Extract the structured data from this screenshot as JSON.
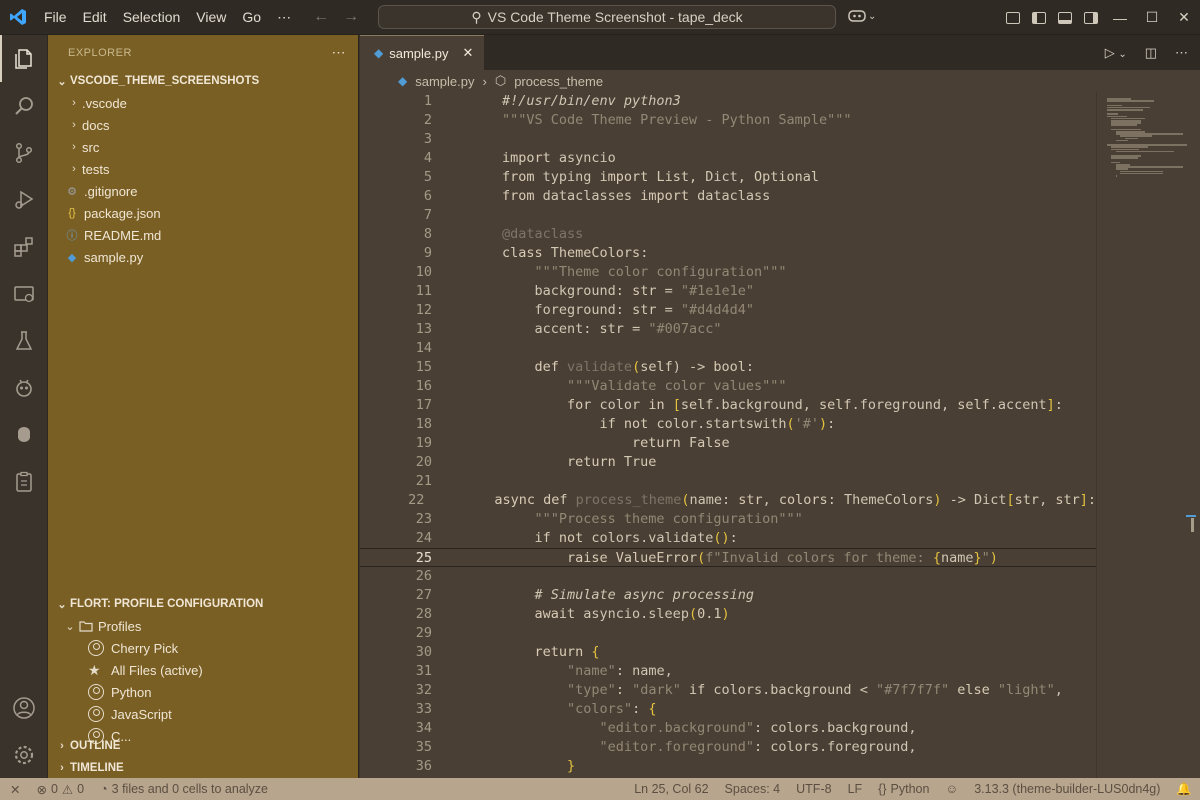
{
  "titlebar": {
    "menus": [
      "File",
      "Edit",
      "Selection",
      "View",
      "Go",
      "⋯"
    ],
    "command_center": "VS Code Theme Screenshot - tape_deck"
  },
  "sidebar": {
    "header": "EXPLORER",
    "root": "VSCODE_THEME_SCREENSHOTS",
    "folders": [
      ".vscode",
      "docs",
      "src",
      "tests"
    ],
    "files": [
      {
        "name": ".gitignore",
        "icon": "gear-icon"
      },
      {
        "name": "package.json",
        "icon": "braces-icon"
      },
      {
        "name": "README.md",
        "icon": "info-icon"
      },
      {
        "name": "sample.py",
        "icon": "python-icon"
      }
    ],
    "profile_section": "FLORT: PROFILE CONFIGURATION",
    "profiles_folder": "Profiles",
    "profiles": [
      "Cherry Pick",
      "All Files (active)",
      "Python",
      "JavaScript",
      "C..."
    ],
    "outline": "OUTLINE",
    "timeline": "TIMELINE"
  },
  "editor": {
    "tab_label": "sample.py",
    "breadcrumb": [
      "sample.py",
      "process_theme"
    ],
    "lines": [
      [
        [
          "#!/usr/bin/env python3",
          "c"
        ]
      ],
      [
        [
          "\"\"\"VS Code Theme Preview - Python Sample\"\"\"",
          "s"
        ]
      ],
      [],
      [
        [
          "import ",
          "k"
        ],
        [
          "asyncio",
          "n"
        ]
      ],
      [
        [
          "from ",
          "k"
        ],
        [
          "typing ",
          "n"
        ],
        [
          "import ",
          "k"
        ],
        [
          "List, ",
          "t"
        ],
        [
          "Dict",
          "n"
        ],
        [
          ", ",
          "t"
        ],
        [
          "Optional",
          "t"
        ]
      ],
      [
        [
          "from ",
          "k"
        ],
        [
          "dataclasses ",
          "n"
        ],
        [
          "import ",
          "k"
        ],
        [
          "dataclass",
          "n"
        ]
      ],
      [],
      [
        [
          "@dataclass",
          "dim"
        ]
      ],
      [
        [
          "class ",
          "k"
        ],
        [
          "ThemeColors",
          "t"
        ],
        [
          ":",
          "n"
        ]
      ],
      [
        [
          "    ",
          "n"
        ],
        [
          "\"\"\"Theme color configuration\"\"\"",
          "s"
        ]
      ],
      [
        [
          "    background",
          "n"
        ],
        [
          ": ",
          "n"
        ],
        [
          "str",
          "t"
        ],
        [
          " = ",
          "n"
        ],
        [
          "\"#1e1e1e\"",
          "s"
        ]
      ],
      [
        [
          "    foreground",
          "n"
        ],
        [
          ": ",
          "n"
        ],
        [
          "str",
          "t"
        ],
        [
          " = ",
          "n"
        ],
        [
          "\"#d4d4d4\"",
          "s"
        ]
      ],
      [
        [
          "    accent",
          "n"
        ],
        [
          ": ",
          "n"
        ],
        [
          "str",
          "t"
        ],
        [
          " = ",
          "n"
        ],
        [
          "\"#007acc\"",
          "s"
        ]
      ],
      [],
      [
        [
          "    def ",
          "k"
        ],
        [
          "validate",
          "dim"
        ],
        [
          "(",
          "y"
        ],
        [
          "self",
          "t"
        ],
        [
          ") -> ",
          "n"
        ],
        [
          "bool",
          "t"
        ],
        [
          ":",
          "n"
        ]
      ],
      [
        [
          "        ",
          "n"
        ],
        [
          "\"\"\"Validate color values\"\"\"",
          "s"
        ]
      ],
      [
        [
          "        for ",
          "k"
        ],
        [
          "color ",
          "n"
        ],
        [
          "in ",
          "k"
        ],
        [
          "[",
          "y"
        ],
        [
          "self",
          "t"
        ],
        [
          ".background, ",
          "n"
        ],
        [
          "self",
          "t"
        ],
        [
          ".foreground, ",
          "n"
        ],
        [
          "self",
          "t"
        ],
        [
          ".accent",
          "n"
        ],
        [
          "]",
          "y"
        ],
        [
          ":",
          "n"
        ]
      ],
      [
        [
          "            if not ",
          "k"
        ],
        [
          "color.startswith",
          "n"
        ],
        [
          "(",
          "y"
        ],
        [
          "'#'",
          "s"
        ],
        [
          ")",
          "y"
        ],
        [
          ":",
          "n"
        ]
      ],
      [
        [
          "                return ",
          "k"
        ],
        [
          "False",
          "t"
        ]
      ],
      [
        [
          "        return ",
          "k"
        ],
        [
          "True",
          "t"
        ]
      ],
      [],
      [
        [
          "async def ",
          "k"
        ],
        [
          "process_theme",
          "dim"
        ],
        [
          "(",
          "y"
        ],
        [
          "name",
          "n"
        ],
        [
          ": ",
          "n"
        ],
        [
          "str",
          "t"
        ],
        [
          ", ",
          "n"
        ],
        [
          "colors",
          "t"
        ],
        [
          ": ",
          "n"
        ],
        [
          "ThemeColors",
          "n"
        ],
        [
          ")",
          "y"
        ],
        [
          " -> ",
          "n"
        ],
        [
          "Dict",
          "n"
        ],
        [
          "[",
          "y"
        ],
        [
          "str",
          "t"
        ],
        [
          ", ",
          "n"
        ],
        [
          "str",
          "t"
        ],
        [
          "]",
          "y"
        ],
        [
          ":",
          "n"
        ]
      ],
      [
        [
          "    ",
          "n"
        ],
        [
          "\"\"\"Process theme configuration\"\"\"",
          "s"
        ]
      ],
      [
        [
          "    if not ",
          "k"
        ],
        [
          "colors.validate",
          "n"
        ],
        [
          "()",
          "y"
        ],
        [
          ":",
          "n"
        ]
      ],
      [
        [
          "        raise ",
          "k"
        ],
        [
          "ValueError",
          "t"
        ],
        [
          "(",
          "y"
        ],
        [
          "f",
          "s"
        ],
        [
          "\"Invalid colors for theme: ",
          "s"
        ],
        [
          "{",
          "y"
        ],
        [
          "name",
          "n"
        ],
        [
          "}",
          "y"
        ],
        [
          "\"",
          "s"
        ],
        [
          ")",
          "y"
        ]
      ],
      [],
      [
        [
          "    # Simulate async processing",
          "c"
        ]
      ],
      [
        [
          "    await ",
          "k"
        ],
        [
          "asyncio.sleep",
          "n"
        ],
        [
          "(",
          "y"
        ],
        [
          "0.1",
          "t"
        ],
        [
          ")",
          "y"
        ]
      ],
      [],
      [
        [
          "    return ",
          "k"
        ],
        [
          "{",
          "y"
        ]
      ],
      [
        [
          "        ",
          "n"
        ],
        [
          "\"name\"",
          "s"
        ],
        [
          ": name,",
          "n"
        ]
      ],
      [
        [
          "        ",
          "n"
        ],
        [
          "\"type\"",
          "s"
        ],
        [
          ": ",
          "n"
        ],
        [
          "\"dark\"",
          "s"
        ],
        [
          " if ",
          "k"
        ],
        [
          "colors.background ",
          "n"
        ],
        [
          "< ",
          "n"
        ],
        [
          "\"#7f7f7f\"",
          "s"
        ],
        [
          " else ",
          "k"
        ],
        [
          "\"light\"",
          "s"
        ],
        [
          ",",
          "n"
        ]
      ],
      [
        [
          "        ",
          "n"
        ],
        [
          "\"colors\"",
          "s"
        ],
        [
          ": ",
          "n"
        ],
        [
          "{",
          "y"
        ]
      ],
      [
        [
          "            ",
          "n"
        ],
        [
          "\"editor.background\"",
          "s"
        ],
        [
          ": colors.background,",
          "n"
        ]
      ],
      [
        [
          "            ",
          "n"
        ],
        [
          "\"editor.foreground\"",
          "s"
        ],
        [
          ": colors.foreground,",
          "n"
        ]
      ],
      [
        [
          "        ",
          "n"
        ],
        [
          "}",
          "y"
        ]
      ]
    ],
    "current_line": 25
  },
  "statusbar": {
    "errors": "0",
    "warnings": "0",
    "analyze": "3 files and 0 cells to analyze",
    "position": "Ln 25, Col 62",
    "spaces": "Spaces: 4",
    "encoding": "UTF-8",
    "eol": "LF",
    "language": "Python",
    "interpreter": "3.13.3 (theme-builder-LUS0dn4g)"
  }
}
